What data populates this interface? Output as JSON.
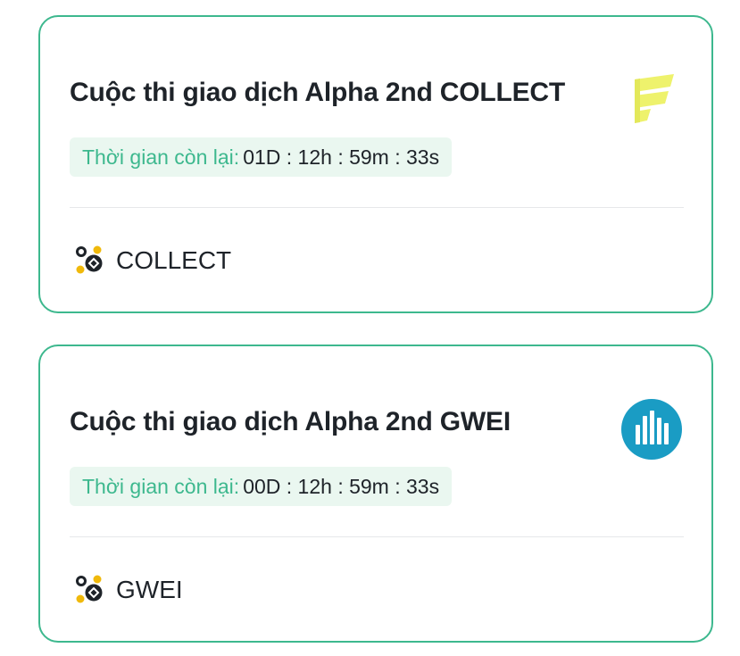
{
  "competitions": [
    {
      "title": "Cuộc thi giao dịch Alpha 2nd COLLECT",
      "time_label": "Thời gian còn lại:",
      "time_value": "01D : 12h : 59m : 33s",
      "token": "COLLECT",
      "logo_icon": "collect-logo-icon",
      "logo_color": "#eef26c"
    },
    {
      "title": "Cuộc thi giao dịch Alpha 2nd GWEI",
      "time_label": "Thời gian còn lại:",
      "time_value": "00D : 12h : 59m : 33s",
      "token": "GWEI",
      "logo_icon": "gwei-logo-icon",
      "logo_color": "#1a9cc4"
    }
  ],
  "colors": {
    "accent": "#3db88e",
    "pill_background": "#eaf7f0",
    "text": "#1e2329",
    "alpha_icon_yellow": "#f0b90b"
  }
}
